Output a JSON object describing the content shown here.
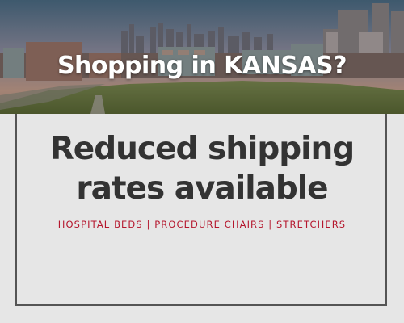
{
  "banner": {
    "headline": "Shopping in KANSAS?",
    "photo_subject": "kansas-city-skyline-photo"
  },
  "offer": {
    "line1": "Reduced shipping",
    "line2": "rates available"
  },
  "products": {
    "text": "HOSPITAL BEDS | PROCEDURE CHAIRS | STRETCHERS"
  },
  "colors": {
    "background": "#e6e6e6",
    "frame": "#555555",
    "headline_text": "#ffffff",
    "offer_text": "#333333",
    "accent": "#b5162d"
  }
}
